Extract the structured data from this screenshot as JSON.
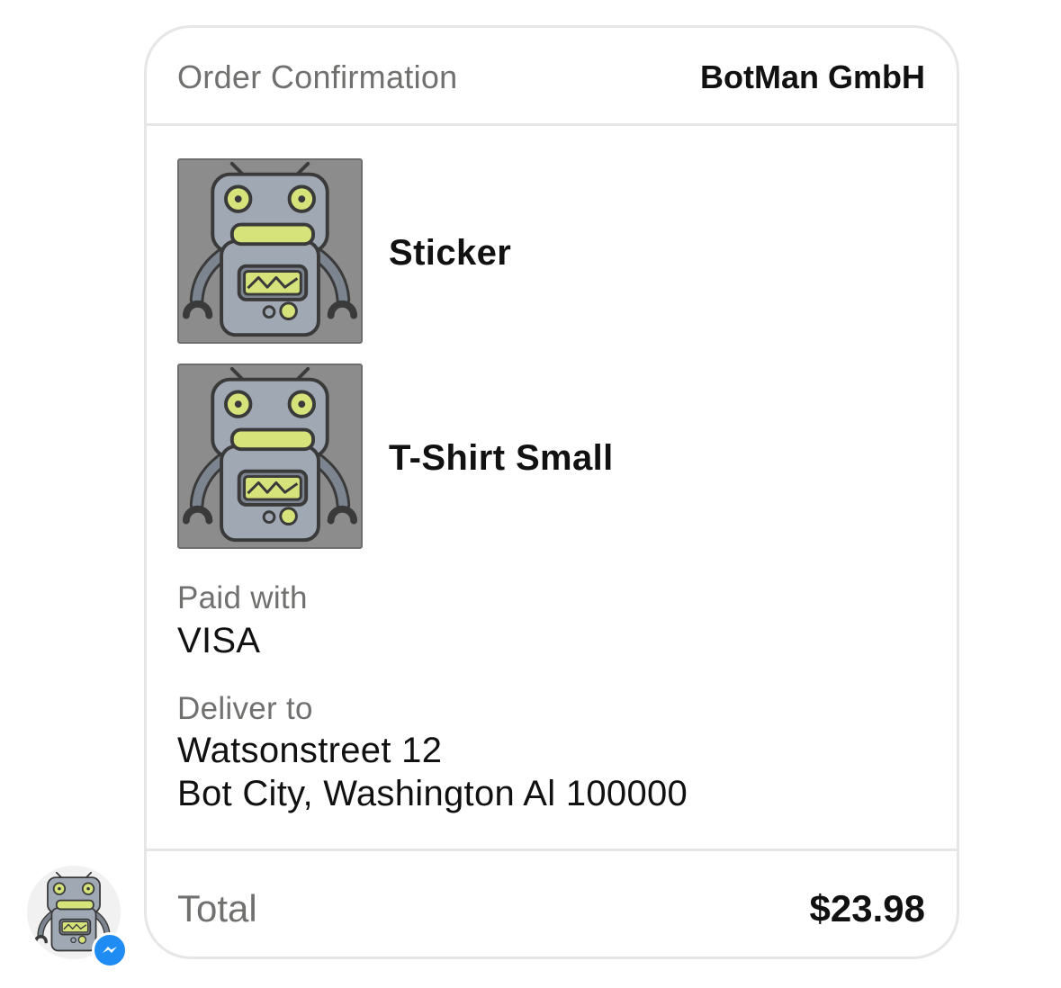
{
  "header": {
    "title": "Order Confirmation",
    "merchant": "BotMan GmbH"
  },
  "items": [
    {
      "name": "Sticker",
      "image_icon": "robot-icon"
    },
    {
      "name": "T-Shirt Small",
      "image_icon": "robot-icon"
    }
  ],
  "payment": {
    "label": "Paid with",
    "method": "VISA"
  },
  "delivery": {
    "label": "Deliver to",
    "address_line1": "Watsonstreet 12",
    "address_line2": "Bot City, Washington Al 100000"
  },
  "summary": {
    "label": "Total",
    "amount": "$23.98"
  },
  "sender": {
    "avatar_icon": "robot-avatar-icon",
    "badge_icon": "messenger-icon"
  },
  "colors": {
    "thumb_background": "#8c8c8c",
    "robot_body": "#9fa8b3",
    "robot_accent": "#d6e27a",
    "messenger_blue": "#1f8cf3",
    "border": "#e6e6e6",
    "muted_text": "#70706f"
  }
}
